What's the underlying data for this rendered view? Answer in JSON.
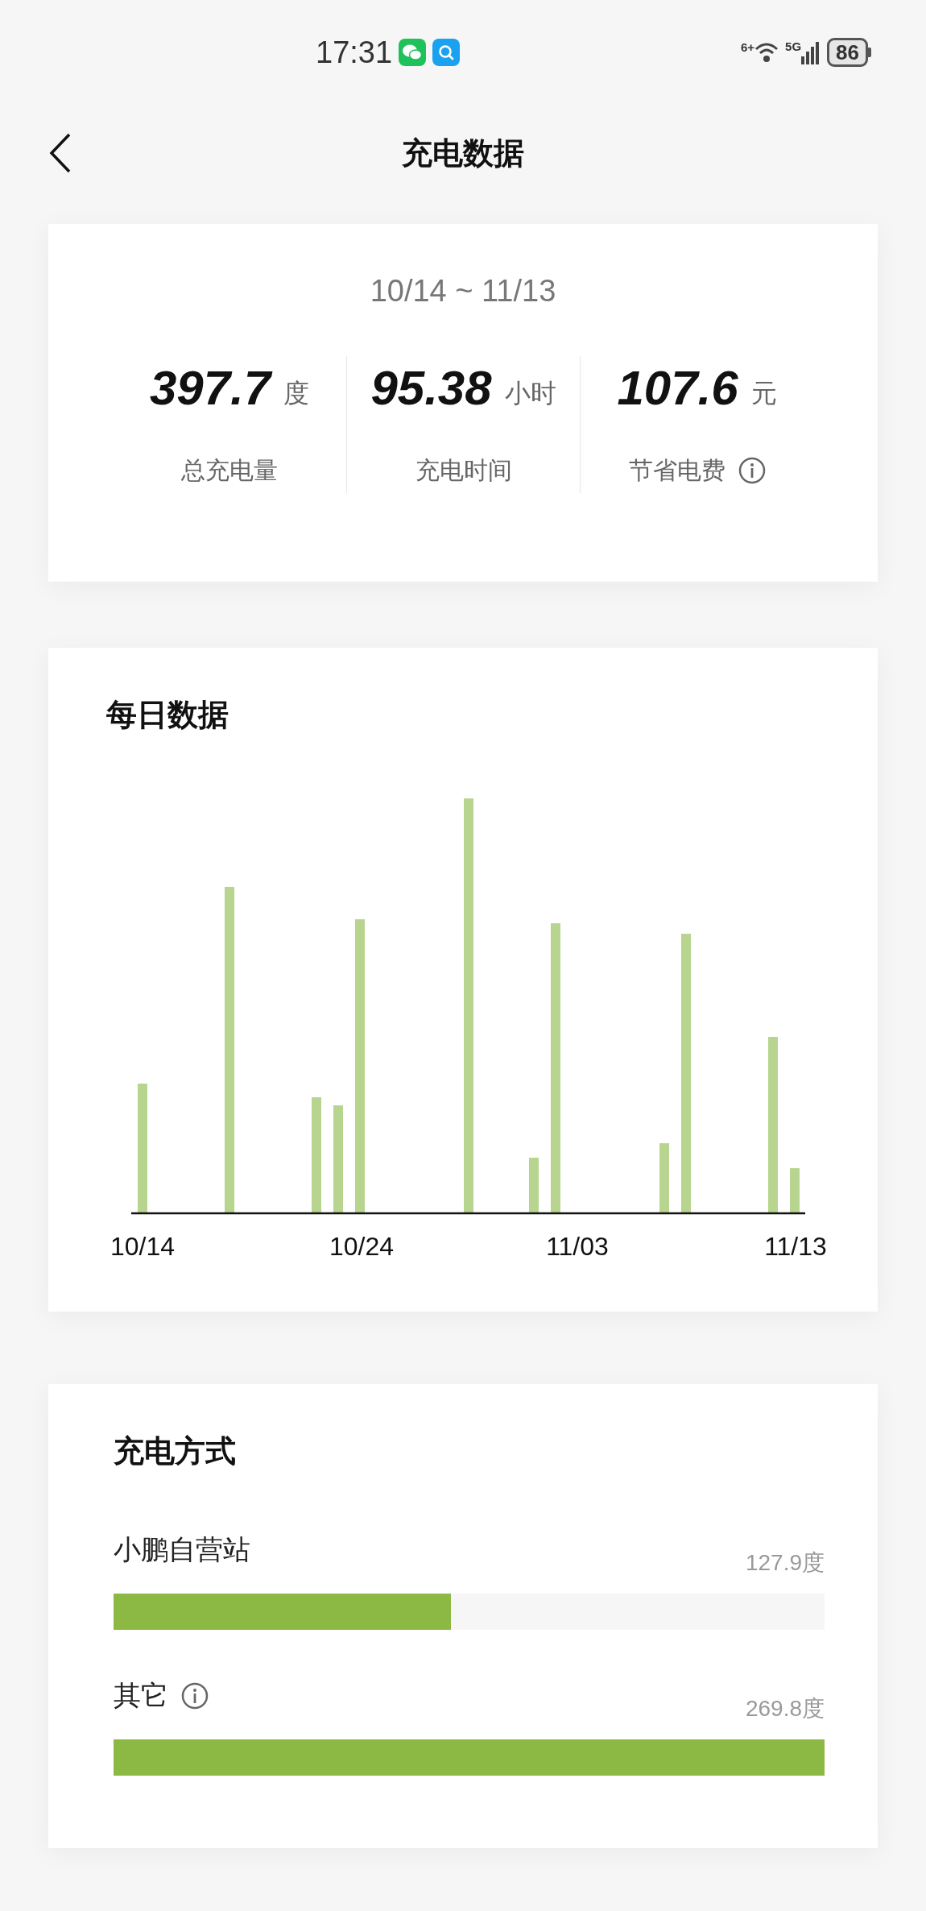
{
  "status_bar": {
    "time": "17:31",
    "wifi_badge": "6+",
    "network": "5G",
    "battery": "86"
  },
  "header": {
    "title": "充电数据"
  },
  "summary": {
    "date_range": "10/14 ~ 11/13",
    "stats": [
      {
        "value": "397.7",
        "unit": "度",
        "label": "总充电量",
        "info": false
      },
      {
        "value": "95.38",
        "unit": "小时",
        "label": "充电时间",
        "info": false
      },
      {
        "value": "107.6",
        "unit": "元",
        "label": "节省电费",
        "info": true
      }
    ]
  },
  "daily": {
    "title": "每日数据",
    "axis_labels": [
      "10/14",
      "10/24",
      "11/03",
      "11/13"
    ]
  },
  "methods": {
    "title": "充电方式",
    "items": [
      {
        "name": "小鹏自营站",
        "value": "127.9度",
        "level": 0.474,
        "info": false
      },
      {
        "name": "其它",
        "value": "269.8度",
        "level": 1,
        "info": true
      }
    ]
  }
}
